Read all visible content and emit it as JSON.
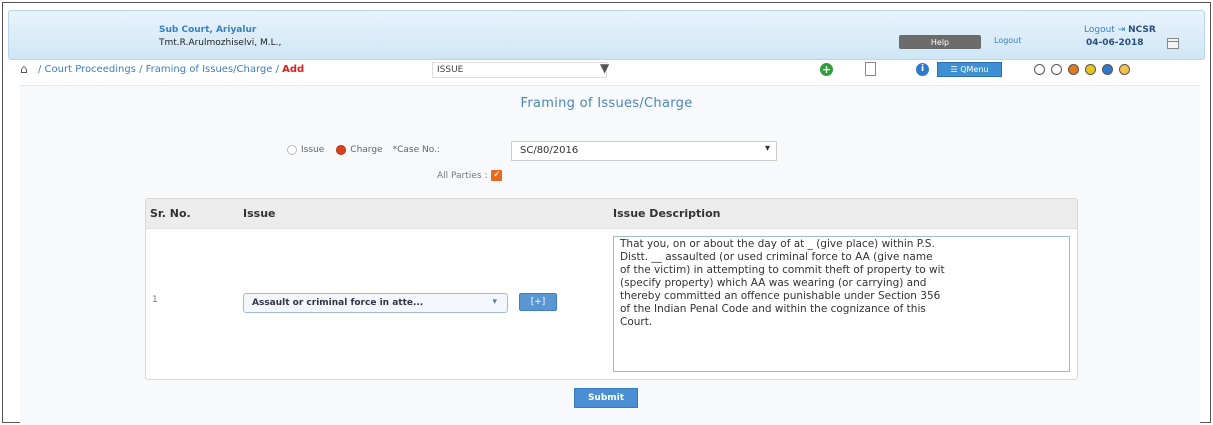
{
  "header": {
    "court_name": "Sub Court, Ariyalur",
    "judge_name": "Tmt.R.Arulmozhiselvi, M.L.,",
    "help_label": "Help",
    "logout_label": "Logout",
    "logout_top": "Logout",
    "logout_user": "NCSR",
    "date": "04-06-2018"
  },
  "nav": {
    "crumbs": "/ Court Proceedings / Framing of Issues/Charge /",
    "add_label": "Add",
    "filter_value": "ISSUE",
    "menu_label": "☰ QMenu"
  },
  "theme_colors": [
    "#ffffff",
    "#ffffff",
    "#e2781f",
    "#e6c51d",
    "#2f79c8",
    "#f3c24a"
  ],
  "form": {
    "title": "Framing of Issues/Charge",
    "radio_issue": "Issue",
    "radio_charge": "Charge",
    "case_label": "*Case No.:",
    "case_value": "SC/80/2016",
    "all_parties_label": "All Parties :"
  },
  "table": {
    "headers": [
      "Sr. No.",
      "Issue",
      "Issue Description"
    ],
    "row": {
      "sr": "1",
      "issue_selected": "Assault or criminal force in atte...",
      "add_btn": "[+]",
      "description": "That you, on or about the day of at _ (give place) within P.S.\nDistt. __ assaulted (or used criminal force to AA (give name\nof the victim) in attempting to commit theft of property to wit\n(specify property) which AA was wearing (or carrying) and\nthereby committed an offence punishable under Section 356\nof the Indian Penal Code and within the cognizance of this\nCourt."
    }
  },
  "submit_label": "Submit"
}
